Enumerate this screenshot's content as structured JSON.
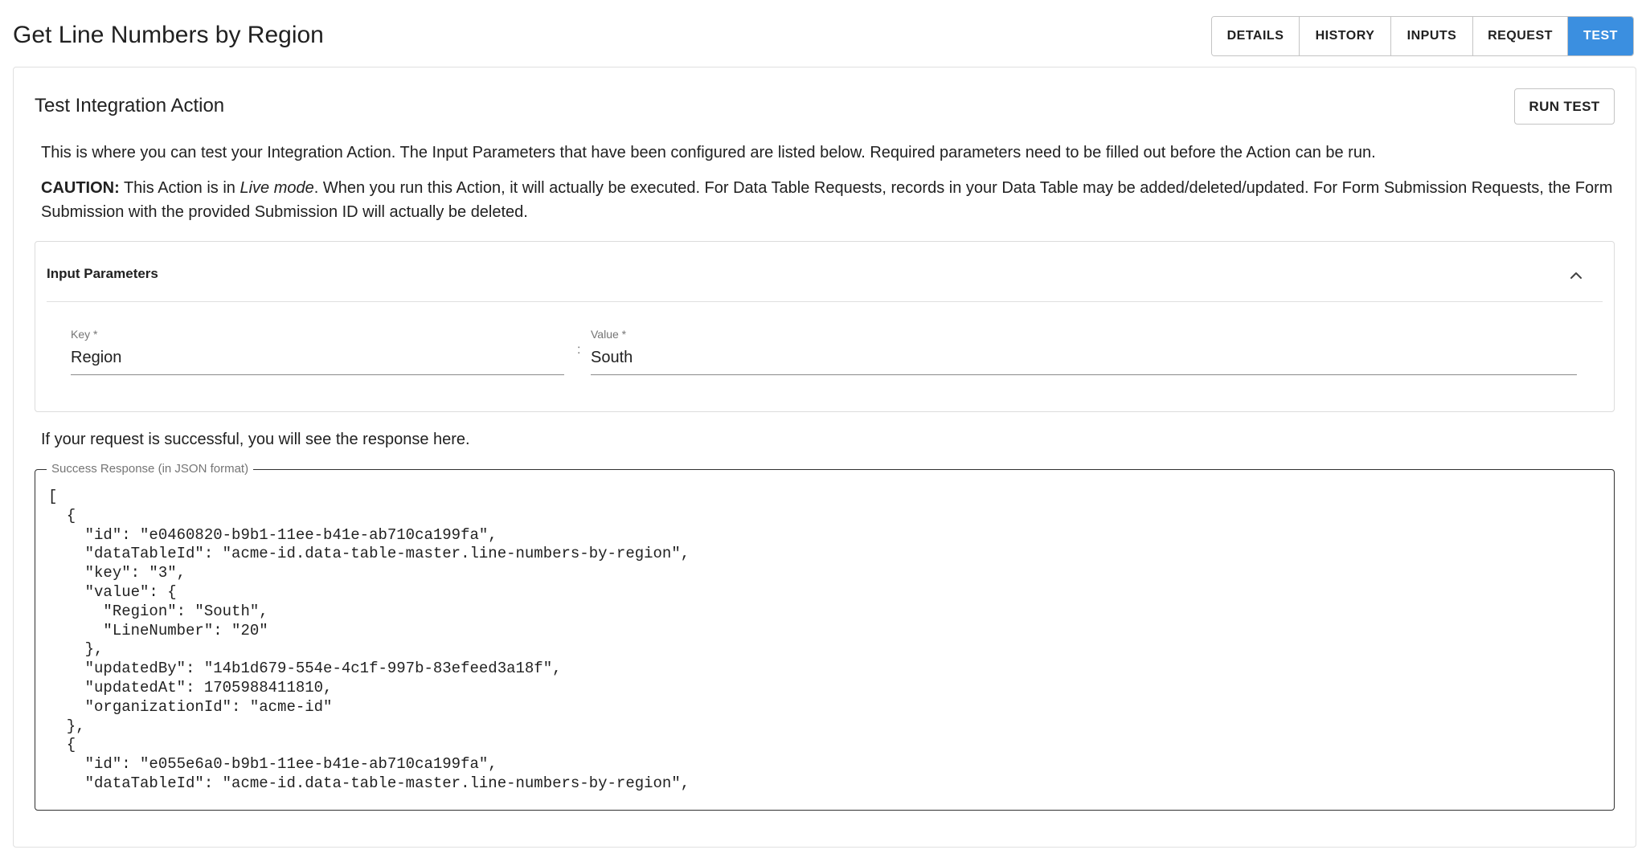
{
  "header": {
    "title": "Get Line Numbers by Region",
    "tabs": [
      {
        "label": "DETAILS",
        "active": false
      },
      {
        "label": "HISTORY",
        "active": false
      },
      {
        "label": "INPUTS",
        "active": false
      },
      {
        "label": "REQUEST",
        "active": false
      },
      {
        "label": "TEST",
        "active": true
      }
    ],
    "accent_color": "#3b8fe0"
  },
  "card": {
    "title": "Test Integration Action",
    "run_test_label": "RUN TEST",
    "intro_text": "This is where you can test your Integration Action. The Input Parameters that have been configured are listed below. Required parameters need to be filled out before the Action can be run.",
    "caution": {
      "label": "CAUTION:",
      "text_before": " This Action is in ",
      "mode": "Live mode",
      "text_after": ". When you run this Action, it will actually be executed. For Data Table Requests, records in your Data Table may be added/deleted/updated. For Form Submission Requests, the Form Submission with the provided Submission ID will actually be deleted."
    }
  },
  "input_parameters": {
    "header": "Input Parameters",
    "collapse_icon": "chevron-up-icon",
    "key_label": "Key *",
    "key_value": "Region",
    "separator": ":",
    "value_label": "Value *",
    "value_value": "South"
  },
  "response": {
    "hint": "If your request is successful, you will see the response here.",
    "legend": "Success Response (in JSON format)",
    "code": "[\n  {\n    \"id\": \"e0460820-b9b1-11ee-b41e-ab710ca199fa\",\n    \"dataTableId\": \"acme-id.data-table-master.line-numbers-by-region\",\n    \"key\": \"3\",\n    \"value\": {\n      \"Region\": \"South\",\n      \"LineNumber\": \"20\"\n    },\n    \"updatedBy\": \"14b1d679-554e-4c1f-997b-83efeed3a18f\",\n    \"updatedAt\": 1705988411810,\n    \"organizationId\": \"acme-id\"\n  },\n  {\n    \"id\": \"e055e6a0-b9b1-11ee-b41e-ab710ca199fa\",\n    \"dataTableId\": \"acme-id.data-table-master.line-numbers-by-region\","
  }
}
